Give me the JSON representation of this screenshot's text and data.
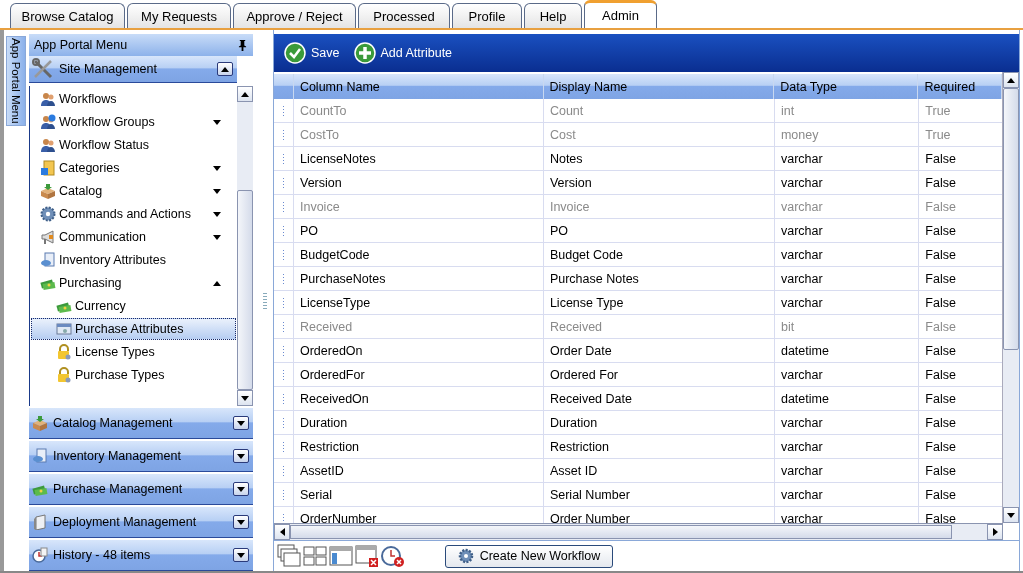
{
  "tabs": [
    {
      "label": "Browse Catalog",
      "selected": false
    },
    {
      "label": "My Requests",
      "selected": false
    },
    {
      "label": "Approve / Reject",
      "selected": false
    },
    {
      "label": "Processed",
      "selected": false
    },
    {
      "label": "Profile",
      "selected": false
    },
    {
      "label": "Help",
      "selected": false
    },
    {
      "label": "Admin",
      "selected": true
    }
  ],
  "side_strip": {
    "label": "App Portal Menu"
  },
  "sidebar": {
    "title": "App Portal Menu",
    "sections": [
      {
        "title": "Site Management",
        "expanded": true,
        "items": [
          {
            "label": "Workflows",
            "selected": false
          },
          {
            "label": "Workflow Groups",
            "selected": false,
            "expanded": false
          },
          {
            "label": "Workflow Status",
            "selected": false
          },
          {
            "label": "Categories",
            "selected": false,
            "expanded": false
          },
          {
            "label": "Catalog",
            "selected": false,
            "expanded": false
          },
          {
            "label": "Commands and Actions",
            "selected": false,
            "expanded": false
          },
          {
            "label": "Communication",
            "selected": false,
            "expanded": false
          },
          {
            "label": "Inventory Attributes",
            "selected": false
          },
          {
            "label": "Purchasing",
            "selected": false,
            "expanded": true,
            "children": [
              {
                "label": "Currency",
                "selected": false
              },
              {
                "label": "Purchase Attributes",
                "selected": true
              },
              {
                "label": "License Types",
                "selected": false
              },
              {
                "label": "Purchase Types",
                "selected": false
              }
            ]
          }
        ]
      },
      {
        "title": "Catalog Management",
        "expanded": false
      },
      {
        "title": "Inventory Management",
        "expanded": false
      },
      {
        "title": "Purchase Management",
        "expanded": false
      },
      {
        "title": "Deployment Management",
        "expanded": false
      },
      {
        "title": "History - 48 items",
        "expanded": false
      }
    ]
  },
  "toolbar": [
    {
      "label": "Save",
      "kind": "save"
    },
    {
      "label": "Add Attribute",
      "kind": "add"
    }
  ],
  "table": {
    "columns": [
      "Column Name",
      "Display Name",
      "Data Type",
      "Required"
    ],
    "rows": [
      {
        "cells": [
          "CountTo",
          "Count",
          "int",
          "True"
        ],
        "disabled": true
      },
      {
        "cells": [
          "CostTo",
          "Cost",
          "money",
          "True"
        ],
        "disabled": true
      },
      {
        "cells": [
          "LicenseNotes",
          "Notes",
          "varchar",
          "False"
        ],
        "disabled": false
      },
      {
        "cells": [
          "Version",
          "Version",
          "varchar",
          "False"
        ],
        "disabled": false
      },
      {
        "cells": [
          "Invoice",
          "Invoice",
          "varchar",
          "False"
        ],
        "disabled": true
      },
      {
        "cells": [
          "PO",
          "PO",
          "varchar",
          "False"
        ],
        "disabled": false
      },
      {
        "cells": [
          "BudgetCode",
          "Budget Code",
          "varchar",
          "False"
        ],
        "disabled": false
      },
      {
        "cells": [
          "PurchaseNotes",
          "Purchase Notes",
          "varchar",
          "False"
        ],
        "disabled": false
      },
      {
        "cells": [
          "LicenseType",
          "License Type",
          "varchar",
          "False"
        ],
        "disabled": false
      },
      {
        "cells": [
          "Received",
          "Received",
          "bit",
          "False"
        ],
        "disabled": true
      },
      {
        "cells": [
          "OrderedOn",
          "Order Date",
          "datetime",
          "False"
        ],
        "disabled": false
      },
      {
        "cells": [
          "OrderedFor",
          "Ordered For",
          "varchar",
          "False"
        ],
        "disabled": false
      },
      {
        "cells": [
          "ReceivedOn",
          "Received Date",
          "datetime",
          "False"
        ],
        "disabled": false
      },
      {
        "cells": [
          "Duration",
          "Duration",
          "varchar",
          "False"
        ],
        "disabled": false
      },
      {
        "cells": [
          "Restriction",
          "Restriction",
          "varchar",
          "False"
        ],
        "disabled": false
      },
      {
        "cells": [
          "AssetID",
          "Asset ID",
          "varchar",
          "False"
        ],
        "disabled": false
      },
      {
        "cells": [
          "Serial",
          "Serial Number",
          "varchar",
          "False"
        ],
        "disabled": false
      },
      {
        "cells": [
          "OrderNumber",
          "Order Number",
          "varchar",
          "False"
        ],
        "disabled": false
      }
    ]
  },
  "footer": {
    "button": "Create New Workflow"
  }
}
